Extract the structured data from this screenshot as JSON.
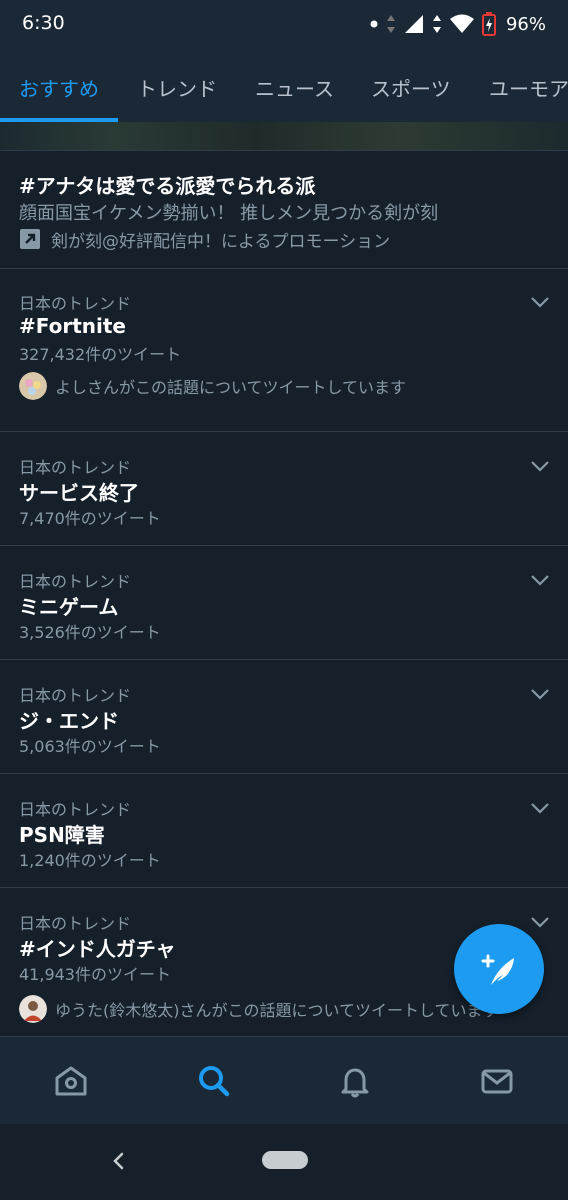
{
  "status": {
    "time": "6:30",
    "battery_pct": "96%",
    "icons": [
      "dot-icon",
      "data-arrows-icon",
      "signal-icon",
      "wifi-arrows-icon",
      "wifi-icon",
      "battery-icon"
    ]
  },
  "tabs": [
    {
      "label": "おすすめ",
      "active": true
    },
    {
      "label": "トレンド"
    },
    {
      "label": "ニュース"
    },
    {
      "label": "スポーツ"
    },
    {
      "label": "ユーモア"
    }
  ],
  "promo": {
    "title": "#アナタは愛でる派愛でられる派",
    "description": "顔面国宝イケメン勢揃い！ 推しメン見つかる剣が刻",
    "promoted_by": "剣が刻@好評配信中！によるプロモーション"
  },
  "trends": [
    {
      "label": "日本のトレンド",
      "name": "#Fortnite",
      "count": "327,432件のツイート",
      "user_text": "よしさんがこの話題についてツイートしています"
    },
    {
      "label": "日本のトレンド",
      "name": "サービス終了",
      "count": "7,470件のツイート"
    },
    {
      "label": "日本のトレンド",
      "name": "ミニゲーム",
      "count": "3,526件のツイート"
    },
    {
      "label": "日本のトレンド",
      "name": "ジ・エンド",
      "count": "5,063件のツイート"
    },
    {
      "label": "日本のトレンド",
      "name": "PSN障害",
      "count": "1,240件のツイート"
    },
    {
      "label": "日本のトレンド",
      "name": "#インド人ガチャ",
      "count": "41,943件のツイート",
      "user_text": "ゆうた(鈴木悠太)さんがこの話題についてツイートしています"
    }
  ],
  "colors": {
    "accent": "#1d9bf0",
    "background": "#15202b",
    "secondary_text": "#8899a6"
  }
}
